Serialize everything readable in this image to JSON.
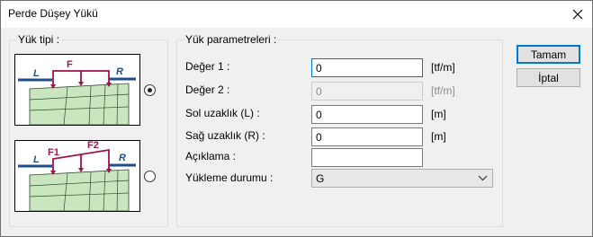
{
  "window": {
    "title": "Perde Düşey Yükü"
  },
  "load_type": {
    "label": "Yük tipi :",
    "option1": {
      "f_label": "F",
      "l_label": "L",
      "r_label": "R",
      "selected": true
    },
    "option2": {
      "f1_label": "F1",
      "f2_label": "F2",
      "l_label": "L",
      "r_label": "R",
      "selected": false
    }
  },
  "params": {
    "label": "Yük parametreleri :",
    "deger1": {
      "label": "Değer 1 :",
      "value": "0",
      "unit": "[tf/m]"
    },
    "deger2": {
      "label": "Değer 2 :",
      "value": "0",
      "unit": "[tf/m]"
    },
    "sol": {
      "label": "Sol uzaklık (L) :",
      "value": "0",
      "unit": "[m]"
    },
    "sag": {
      "label": "Sağ uzaklık (R) :",
      "value": "0",
      "unit": "[m]"
    },
    "aciklama": {
      "label": "Açıklama :",
      "value": ""
    },
    "yukleme": {
      "label": "Yükleme durumu :",
      "value": "G"
    }
  },
  "buttons": {
    "ok": "Tamam",
    "cancel": "İptal"
  },
  "colors": {
    "accent": "#0078d7",
    "load": "#a0104a",
    "support": "#1f4e8c",
    "wall": "#c9e6bf"
  }
}
